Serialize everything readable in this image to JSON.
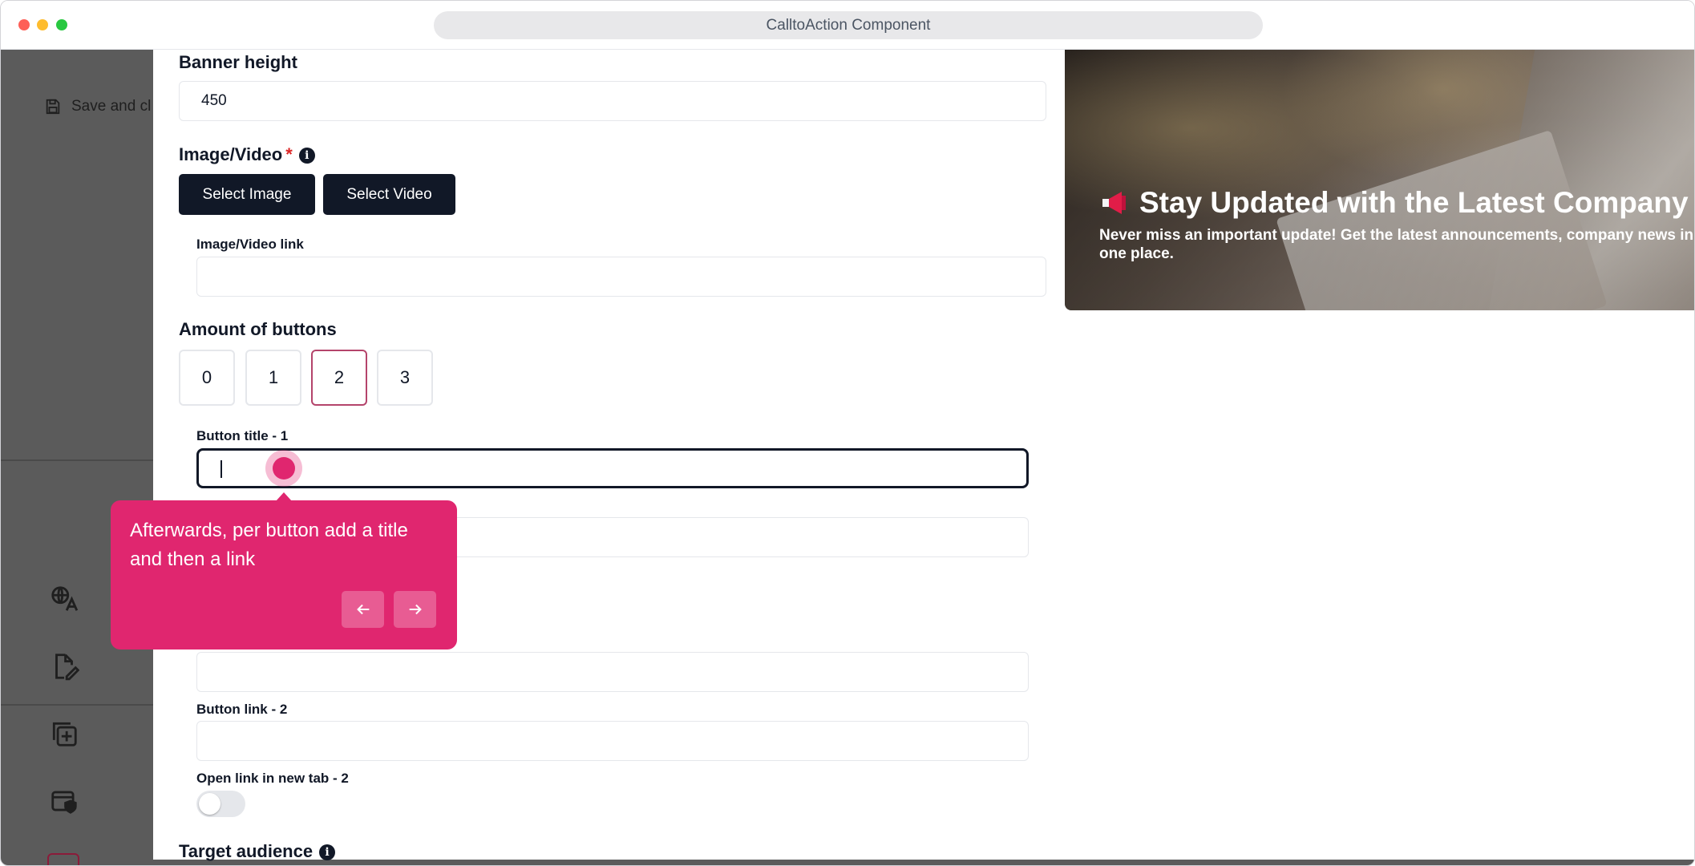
{
  "window": {
    "title": "CalltoAction Component"
  },
  "sidebar": {
    "save_close_label": "Save and cl",
    "icons": [
      "translate-icon",
      "edit-document-icon",
      "add-copy-icon",
      "shield-card-icon"
    ]
  },
  "form": {
    "banner_height": {
      "label": "Banner height",
      "value": "450"
    },
    "media": {
      "label": "Image/Video",
      "required_mark": "*",
      "select_image_label": "Select Image",
      "select_video_label": "Select Video",
      "link_label": "Image/Video link",
      "link_value": ""
    },
    "buttons_amount": {
      "label": "Amount of buttons",
      "options": [
        "0",
        "1",
        "2",
        "3"
      ],
      "selected": "2"
    },
    "button_title_1": {
      "label": "Button title - 1",
      "value": ""
    },
    "button_link_2": {
      "label": "Button link - 2",
      "value": ""
    },
    "open_new_tab_2": {
      "label": "Open link in new tab - 2",
      "checked": false
    },
    "target_audience": {
      "label": "Target audience"
    }
  },
  "preview": {
    "title": "Stay Updated with the Latest Company",
    "description": "Never miss an important update! Get the latest announcements, company news in one place."
  },
  "tour": {
    "text": "Afterwards, per button add a title and then a link",
    "accent": "#e0266f"
  }
}
